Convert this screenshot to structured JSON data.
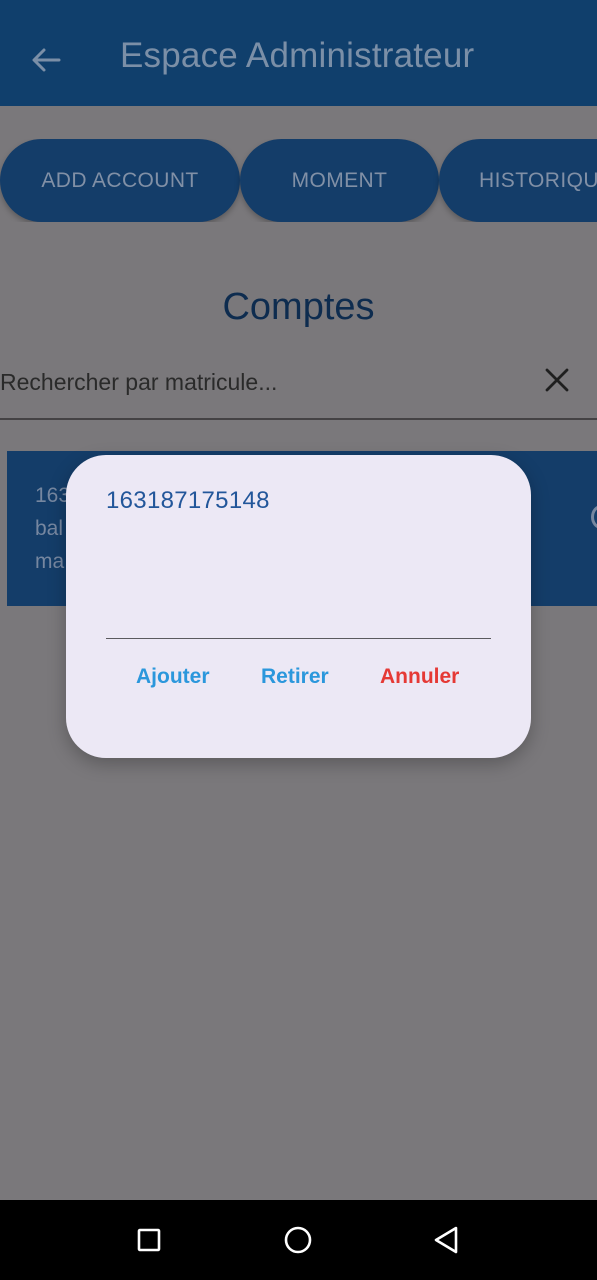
{
  "appbar": {
    "title": "Espace Administrateur",
    "back_icon": "arrow-left-icon"
  },
  "chips": [
    {
      "label": "ADD ACCOUNT"
    },
    {
      "label": "MOMENT"
    },
    {
      "label": "HISTORIQU"
    }
  ],
  "section": {
    "title": "Comptes"
  },
  "search": {
    "placeholder": "Rechercher par matricule...",
    "clear_icon": "close-icon"
  },
  "account_card": {
    "line1": "163",
    "line2": "bal",
    "line3": "ma"
  },
  "dialog": {
    "value": "163187175148",
    "actions": {
      "add": "Ajouter",
      "remove": "Retirer",
      "cancel": "Annuler"
    }
  },
  "colors": {
    "appbar": "#103f6c",
    "chip": "#143d69",
    "dialog_bg": "#ece8f5",
    "action_blue": "#2b97dc",
    "action_red": "#e53935",
    "scrim": "#7a787b"
  },
  "navbar": {
    "icons": [
      "square-recent-apps-icon",
      "circle-home-icon",
      "triangle-back-icon"
    ]
  }
}
